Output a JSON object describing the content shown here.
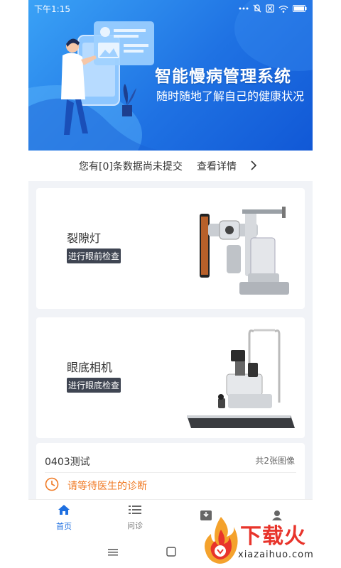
{
  "status_bar": {
    "time": "下午1:15",
    "icons": [
      "dots-icon",
      "mute-icon",
      "no-sim-icon",
      "wifi-icon",
      "battery-icon"
    ]
  },
  "banner": {
    "title": "智能慢病管理系统",
    "subtitle": "随时随地了解自己的健康状况"
  },
  "notice": {
    "text": "您有[0]条数据尚未提交",
    "link": "查看详情"
  },
  "devices": [
    {
      "name": "裂隙灯",
      "action": "进行眼前检查"
    },
    {
      "name": "眼底相机",
      "action": "进行眼底检查"
    }
  ],
  "record": {
    "name": "0403测试",
    "count": "共2张图像",
    "status": "请等待医生的诊断"
  },
  "tabs": [
    {
      "label": "首页",
      "icon": "home-icon",
      "active": true
    },
    {
      "label": "问诊",
      "icon": "list-icon",
      "active": false
    },
    {
      "label": "",
      "icon": "archive-icon",
      "active": false
    },
    {
      "label": "",
      "icon": "user-icon",
      "active": false
    }
  ],
  "watermark": {
    "text": "下载火",
    "url": "xiazaihuo.com"
  },
  "colors": {
    "accent": "#1e6fe0",
    "warning": "#f07a24",
    "tag_bg": "#3f4552",
    "watermark_red": "#e8342b"
  }
}
